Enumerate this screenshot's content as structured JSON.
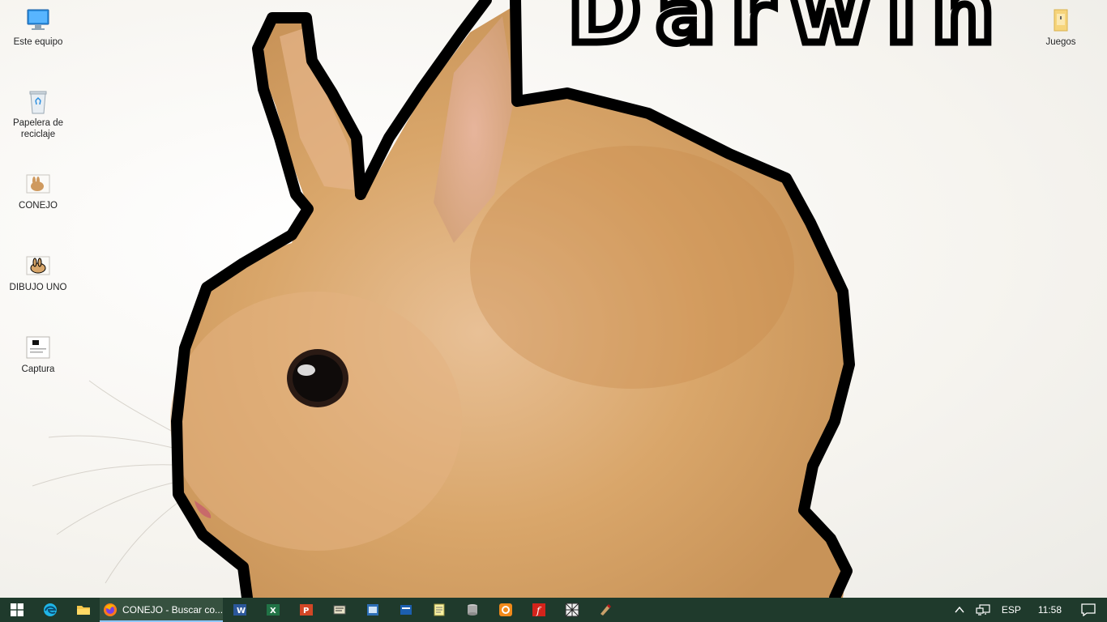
{
  "wallpaper": {
    "handwritten_text": "Darwin",
    "colors": {
      "background": "#f7f5f1",
      "fur": "#d9a66a",
      "fur_shadow": "#b98246",
      "outline": "#000000"
    }
  },
  "desktop_icons": [
    {
      "label": "Este equipo",
      "icon": "computer-icon"
    },
    {
      "label": "Papelera de reciclaje",
      "icon": "recycle-bin-icon"
    },
    {
      "label": "CONEJO",
      "icon": "rabbit-image-icon"
    },
    {
      "label": "DIBUJO UNO",
      "icon": "rabbit-drawing-icon"
    },
    {
      "label": "Captura",
      "icon": "screenshot-file-icon"
    },
    {
      "label": "Juegos",
      "icon": "folder-icon"
    }
  ],
  "taskbar": {
    "colors": {
      "background": "#1f3a2c",
      "active": "#36513f",
      "indicator": "#8fc7ff"
    },
    "start_icon": "windows-logo-icon",
    "pinned": [
      {
        "icon": "edge-icon"
      },
      {
        "icon": "file-explorer-icon"
      },
      {
        "icon": "firefox-icon",
        "window_title": "CONEJO - Buscar co..."
      },
      {
        "icon": "word-icon"
      },
      {
        "icon": "excel-icon"
      },
      {
        "icon": "powerpoint-icon"
      },
      {
        "icon": "pseint-icon"
      },
      {
        "icon": "visual-basic-icon"
      },
      {
        "icon": "dfd-icon"
      },
      {
        "icon": "notepad-icon"
      },
      {
        "icon": "database-icon"
      },
      {
        "icon": "scratch-icon"
      },
      {
        "icon": "flash-icon"
      },
      {
        "icon": "grid-tool-icon"
      },
      {
        "icon": "misc-app-icon"
      }
    ],
    "tray": {
      "chevron_icon": "chevron-up-icon",
      "network_icon": "network-icon",
      "language": "ESP",
      "time": "11:58",
      "notifications_icon": "notification-icon"
    }
  }
}
